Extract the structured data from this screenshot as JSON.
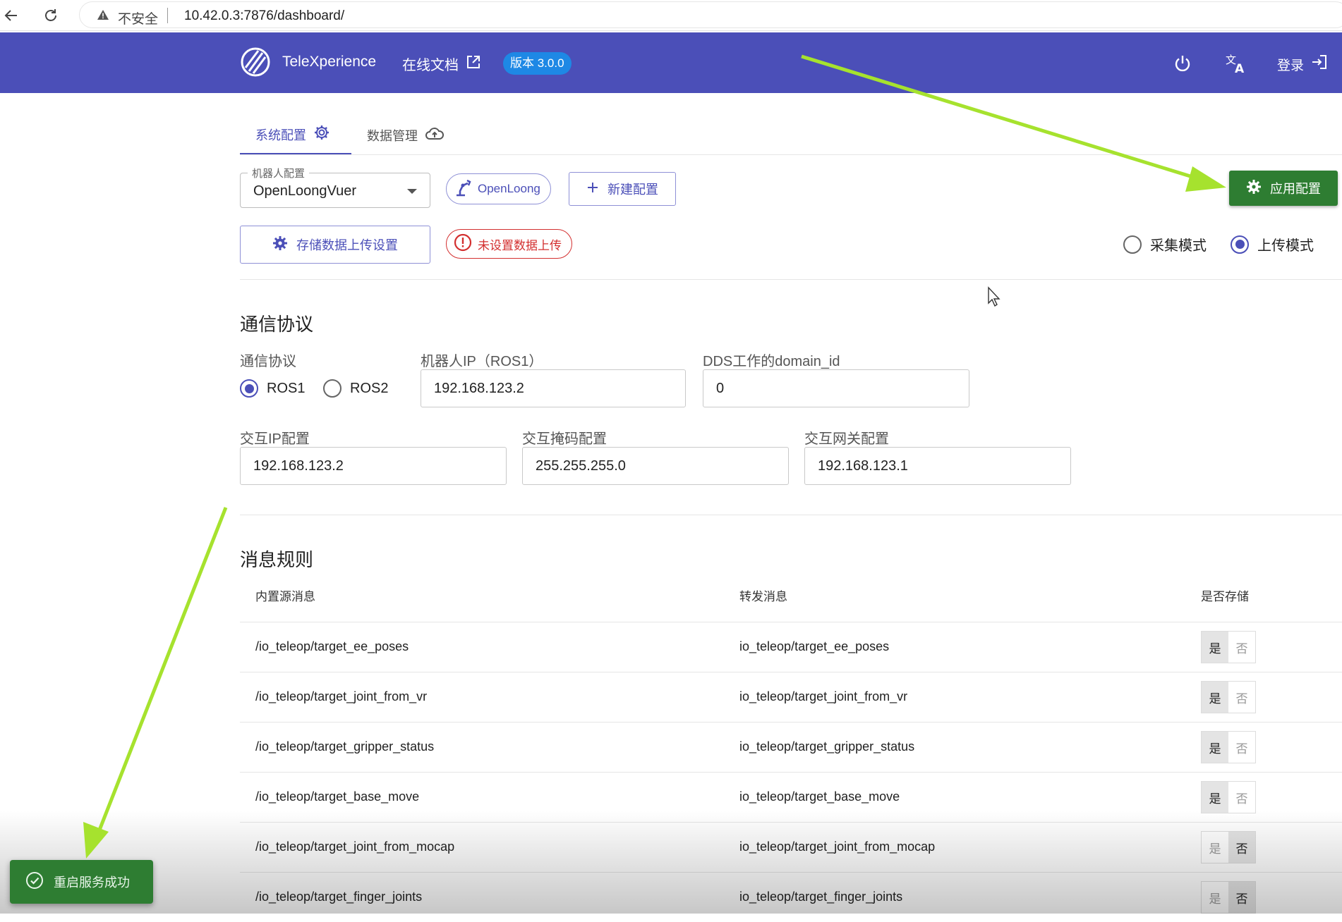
{
  "browser": {
    "security_label": "不安全",
    "url": "10.42.0.3:7876/dashboard/"
  },
  "header": {
    "brand": "TeleXperience",
    "docs_label": "在线文档",
    "version": "版本 3.0.0",
    "login_label": "登录"
  },
  "tabs": [
    {
      "label": "系统配置",
      "active": true
    },
    {
      "label": "数据管理",
      "active": false
    }
  ],
  "config": {
    "robot_select_label": "机器人配置",
    "robot_select_value": "OpenLoongVuer",
    "robot_chip": "OpenLoong",
    "new_config_label": "新建配置",
    "apply_label": "应用配置",
    "upload_settings_label": "存储数据上传设置",
    "upload_status_label": "未设置数据上传",
    "modes": [
      {
        "label": "采集模式",
        "selected": false
      },
      {
        "label": "上传模式",
        "selected": true
      }
    ]
  },
  "comm": {
    "title": "通信协议",
    "protocol_label": "通信协议",
    "protocols": [
      {
        "label": "ROS1",
        "selected": true
      },
      {
        "label": "ROS2",
        "selected": false
      }
    ],
    "robot_ip_label": "机器人IP（ROS1）",
    "robot_ip": "192.168.123.2",
    "dds_label": "DDS工作的domain_id",
    "dds_value": "0",
    "interact_ip_label": "交互IP配置",
    "interact_ip": "192.168.123.2",
    "mask_label": "交互掩码配置",
    "mask": "255.255.255.0",
    "gateway_label": "交互网关配置",
    "gateway": "192.168.123.1"
  },
  "rules": {
    "title": "消息规则",
    "headers": [
      "内置源消息",
      "转发消息",
      "是否存储"
    ],
    "yes_label": "是",
    "no_label": "否",
    "rows": [
      {
        "source": "/io_teleop/target_ee_poses",
        "forward": "io_teleop/target_ee_poses",
        "store": true
      },
      {
        "source": "/io_teleop/target_joint_from_vr",
        "forward": "io_teleop/target_joint_from_vr",
        "store": true
      },
      {
        "source": "/io_teleop/target_gripper_status",
        "forward": "io_teleop/target_gripper_status",
        "store": true
      },
      {
        "source": "/io_teleop/target_base_move",
        "forward": "io_teleop/target_base_move",
        "store": true
      },
      {
        "source": "/io_teleop/target_joint_from_mocap",
        "forward": "io_teleop/target_joint_from_mocap",
        "store": false
      },
      {
        "source": "/io_teleop/target_finger_joints",
        "forward": "io_teleop/target_finger_joints",
        "store": false
      }
    ]
  },
  "snackbar": {
    "message": "重启服务成功"
  },
  "colors": {
    "primary": "#4b4fb8",
    "success": "#2e7d32",
    "error": "#d32f2f",
    "annotation_arrow": "#a6e22e"
  }
}
